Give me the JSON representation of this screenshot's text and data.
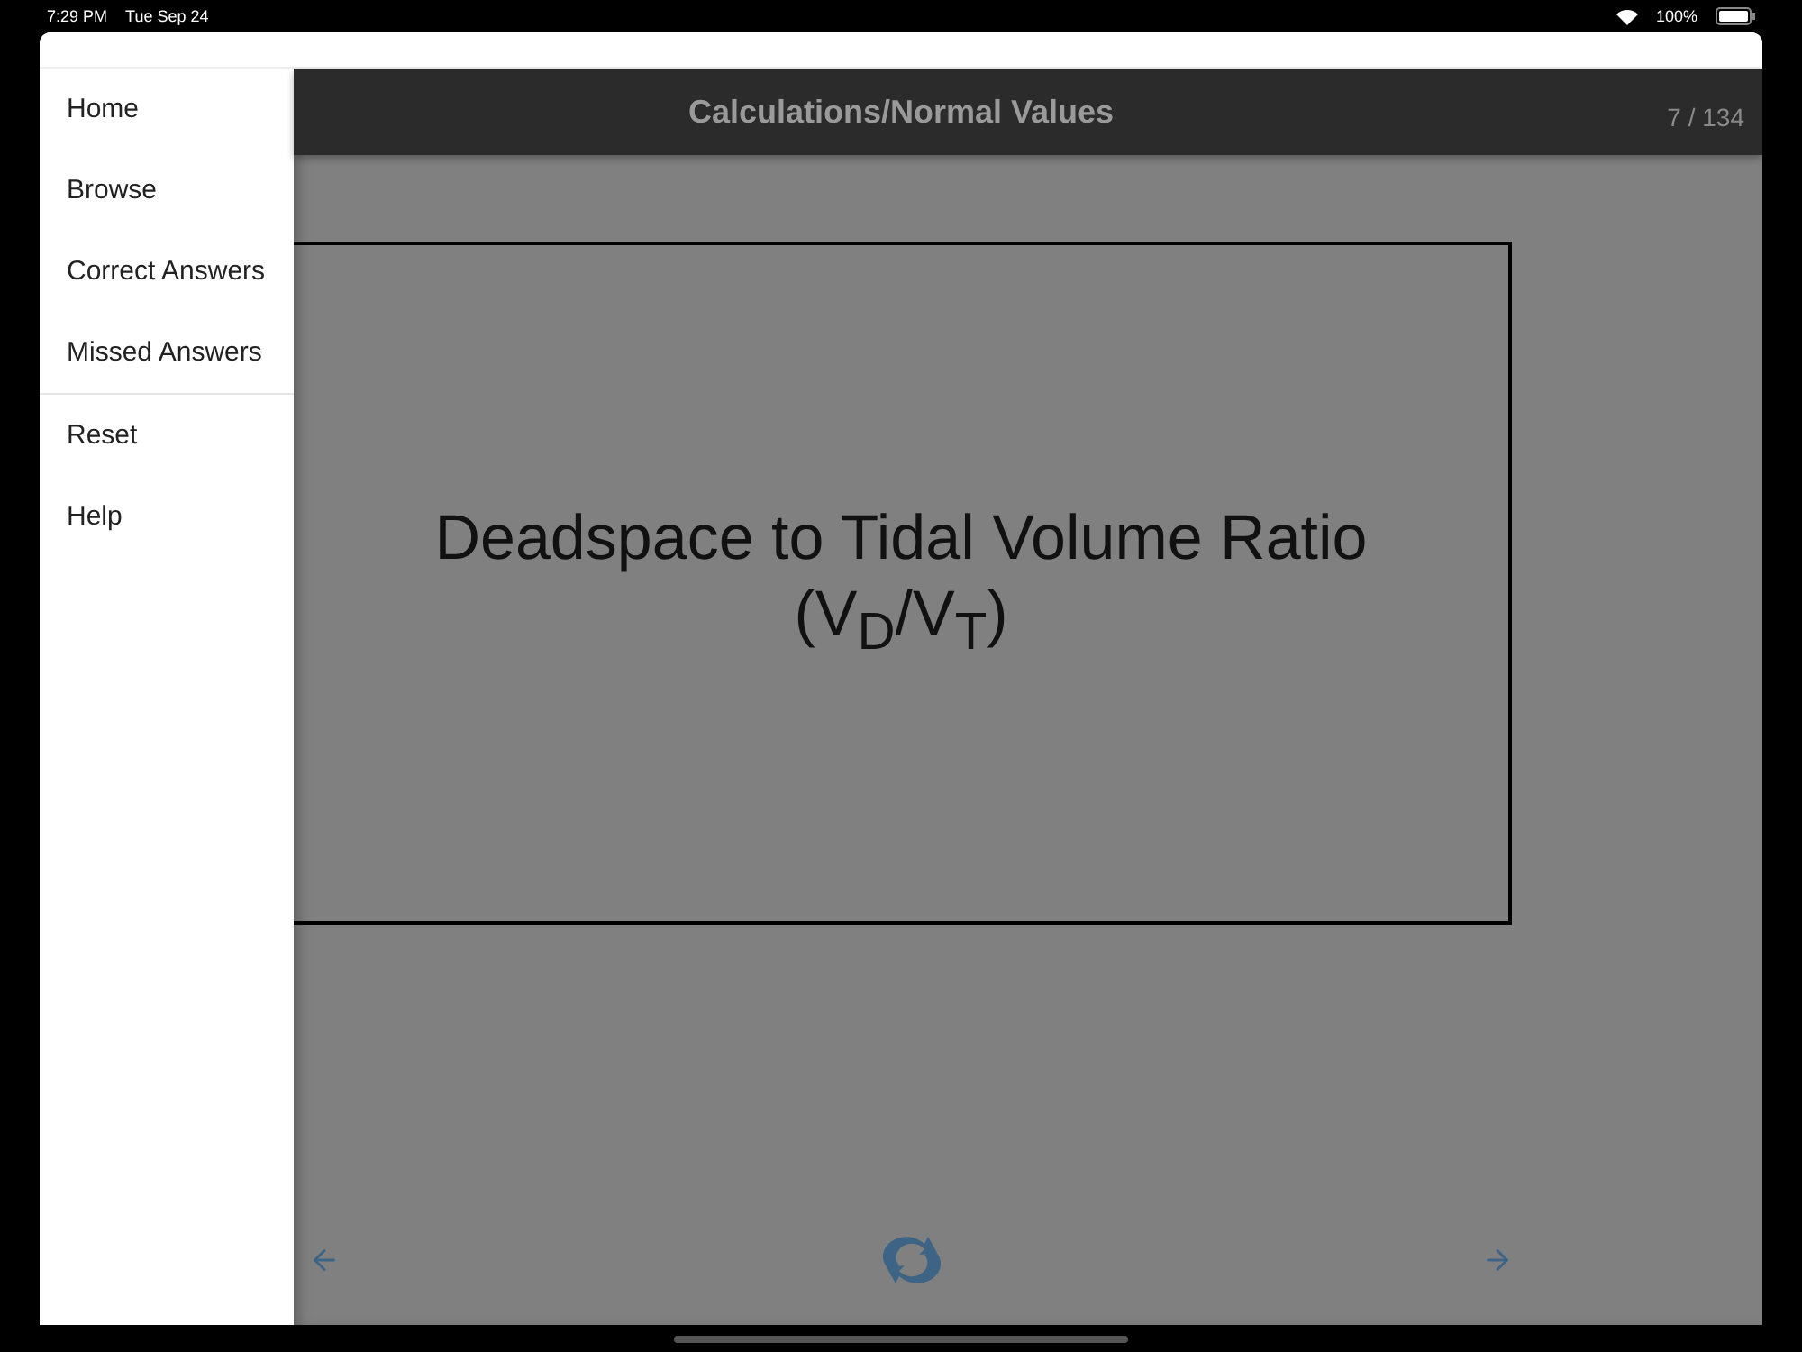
{
  "status_bar": {
    "time": "7:29 PM",
    "date": "Tue Sep 24",
    "battery": "100%"
  },
  "menu": {
    "sections": [
      [
        {
          "label": "Home"
        },
        {
          "label": "Browse"
        },
        {
          "label": "Correct Answers"
        },
        {
          "label": "Missed Answers"
        }
      ],
      [
        {
          "label": "Reset"
        },
        {
          "label": "Help"
        }
      ]
    ]
  },
  "header": {
    "title": "Calculations/Normal Values",
    "counter": "7 / 134"
  },
  "card": {
    "lines": [
      "Deadspace to Tidal Volume Ratio",
      "(V$_{D}$/V$_{T}$)"
    ]
  }
}
